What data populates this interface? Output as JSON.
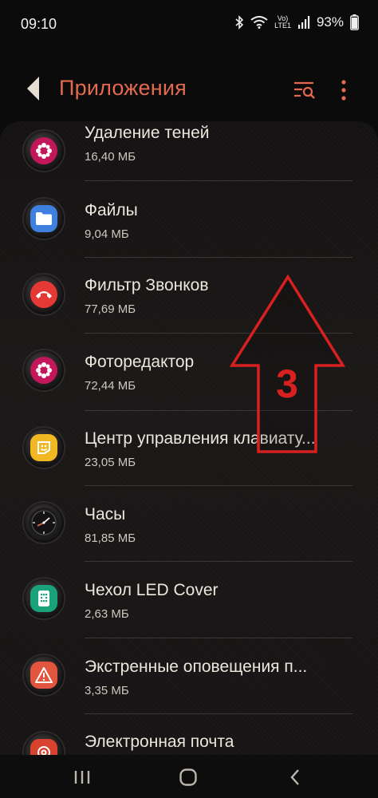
{
  "status_bar": {
    "time": "09:10",
    "lte_top": "Vo)",
    "lte_bottom": "LTE1",
    "battery_percent": "93%",
    "icons": [
      "bluetooth-icon",
      "wifi-icon",
      "signal-icon",
      "battery-icon"
    ]
  },
  "header": {
    "title": "Приложения",
    "back_icon": "back-arrow-icon",
    "search_icon": "filter-search-icon",
    "more_icon": "more-vert-icon",
    "accent_color": "#e36a4f"
  },
  "apps": [
    {
      "name": "Удаление теней",
      "size": "16,40 МБ",
      "icon": "shadow-eraser-icon",
      "color": "#c2185b"
    },
    {
      "name": "Файлы",
      "size": "9,04 МБ",
      "icon": "files-icon",
      "color": "#3f7fe0"
    },
    {
      "name": "Фильтр Звонков",
      "size": "77,69 МБ",
      "icon": "call-filter-icon",
      "color": "#e53935"
    },
    {
      "name": "Фоторедактор",
      "size": "72,44 МБ",
      "icon": "photo-editor-icon",
      "color": "#c2185b"
    },
    {
      "name": "Центр управления клавиату...",
      "size": "23,05 МБ",
      "icon": "keyboard-center-icon",
      "color": "#f2b824"
    },
    {
      "name": "Часы",
      "size": "81,85 МБ",
      "icon": "clock-icon",
      "color": "#1d1b1b"
    },
    {
      "name": "Чехол LED Cover",
      "size": "2,63 МБ",
      "icon": "led-cover-icon",
      "color": "#1aa37a"
    },
    {
      "name": "Экстренные оповещения п...",
      "size": "3,35 МБ",
      "icon": "emergency-alert-icon",
      "color": "#e2553f"
    },
    {
      "name": "Электронная почта",
      "size": "",
      "icon": "email-icon",
      "color": "#d8432f"
    }
  ],
  "annotation": {
    "label": "3",
    "color": "#d92020"
  },
  "nav_bar": {
    "recents_icon": "recents-icon",
    "home_icon": "home-icon",
    "back_icon": "nav-back-icon"
  }
}
